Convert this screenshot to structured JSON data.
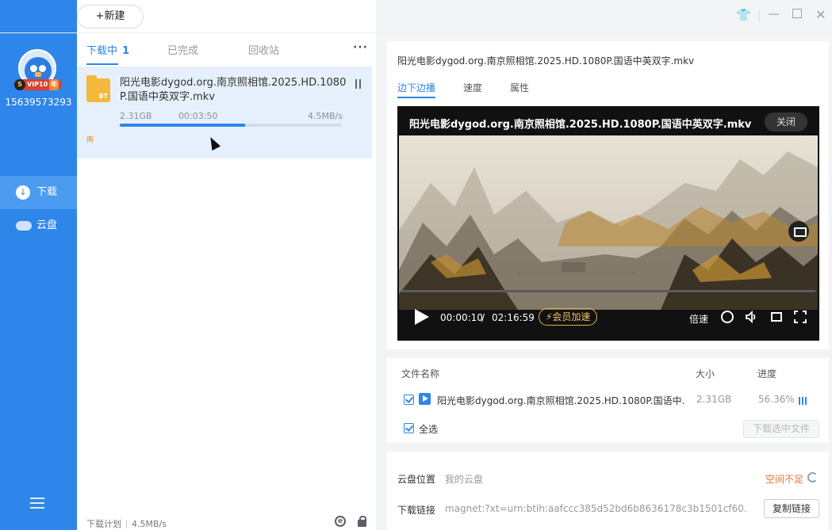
{
  "sidebar": {
    "vip_label": "VIP10",
    "vip_year": "年",
    "user_id": "15639573293",
    "items": [
      {
        "label": "下载"
      },
      {
        "label": "云盘"
      }
    ]
  },
  "toolbar": {
    "new_label": "新建"
  },
  "list_tabs": [
    {
      "label": "下载中",
      "count": "1"
    },
    {
      "label": "已完成"
    },
    {
      "label": "回收站"
    }
  ],
  "more_label": "···",
  "task": {
    "name": "阳光电影dygod.org.南京照相馆.2025.HD.1080P.国语中英双字.mkv",
    "size": "2.31GB",
    "remaining": "00:03:50",
    "speed": "4.5MB/s",
    "progress_pct": 56.36,
    "folder_badge": "BT",
    "flag": "南"
  },
  "footer": {
    "plan_label": "下载计划",
    "speed": "4.5MB/s"
  },
  "detail": {
    "title": "阳光电影dygod.org.南京照相馆.2025.HD.1080P.国语中英双字.mkv",
    "tabs": [
      "边下边播",
      "速度",
      "属性"
    ]
  },
  "player": {
    "title": "阳光电影dygod.org.南京照相馆.2025.HD.1080P.国语中英双字.mkv",
    "close_label": "关闭",
    "current_time": "00:00:10",
    "separator": "/",
    "total_time": "02:16:59",
    "vip_speed_label": "⚡会员加速",
    "speed_label": "倍速"
  },
  "files": {
    "headers": {
      "name": "文件名称",
      "size": "大小",
      "progress": "进度"
    },
    "rows": [
      {
        "name": "阳光电影dygod.org.南京照相馆.2025.HD.1080P.国语中...",
        "size": "2.31GB",
        "progress": "56.36%"
      }
    ],
    "select_all_label": "全选",
    "download_selected_label": "下载选中文件"
  },
  "cloud": {
    "location_label": "云盘位置",
    "location_value": "我的云盘",
    "space_warning": "空间不足",
    "link_label": "下载链接",
    "link_value": "magnet:?xt=urn:btih:aafccc385d52bd6b8636178c3b1501cf60...",
    "copy_label": "复制链接"
  },
  "colors": {
    "accent": "#2e86ea",
    "sidebar": "#2e86ea",
    "warning": "#e5743a",
    "vip_gold": "#f2c264"
  }
}
